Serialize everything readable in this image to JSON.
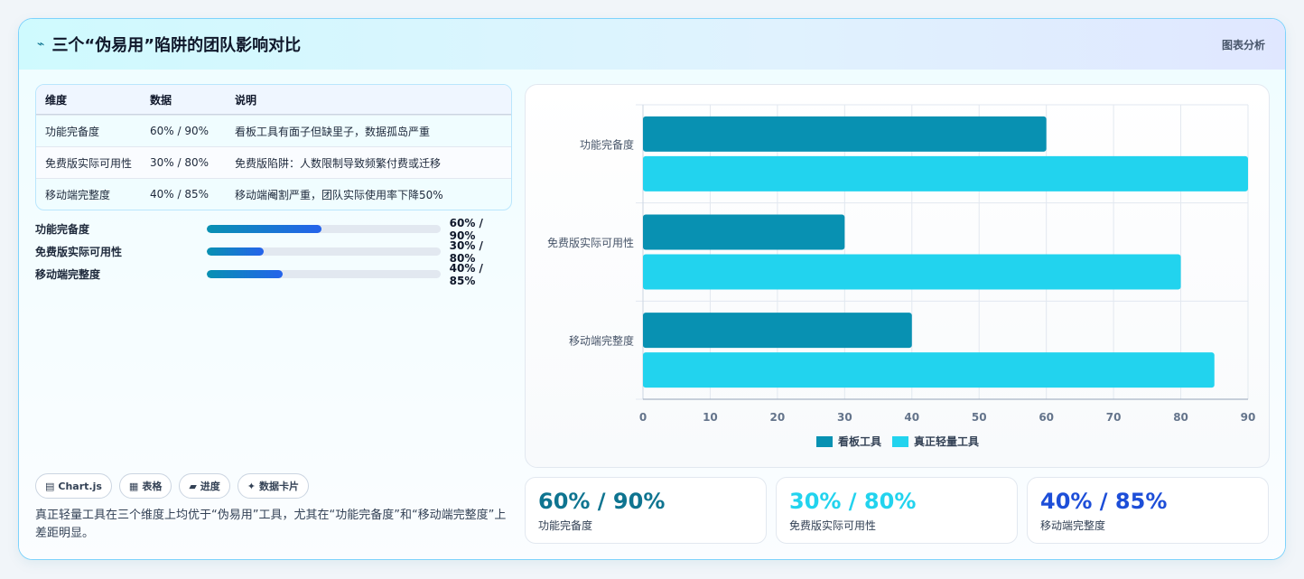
{
  "header": {
    "title": "三个“伪易用”陷阱的团队影响对比",
    "right_label": "图表分析",
    "icon": "lightning-icon"
  },
  "table": {
    "headers": [
      "维度",
      "数据",
      "说明"
    ],
    "rows": [
      {
        "dim": "功能完备度",
        "data": "60% / 90%",
        "desc": "看板工具有面子但缺里子，数据孤岛严重"
      },
      {
        "dim": "免费版实际可用性",
        "data": "30% / 80%",
        "desc": "免费版陷阱：人数限制导致频繁付费或迁移"
      },
      {
        "dim": "移动端完整度",
        "data": "40% / 85%",
        "desc": "移动端阉割严重，团队实际使用率下降50%"
      }
    ]
  },
  "progress": [
    {
      "label": "功能完备度",
      "value": 0.49,
      "text": "60% / 90%"
    },
    {
      "label": "免费版实际可用性",
      "value": 0.245,
      "text": "30% / 80%"
    },
    {
      "label": "移动端完整度",
      "value": 0.325,
      "text": "40% / 85%"
    }
  ],
  "chips": [
    {
      "icon": "chart-icon",
      "glyph": "▤",
      "label": "Chart.js"
    },
    {
      "icon": "table-icon",
      "glyph": "▦",
      "label": "表格"
    },
    {
      "icon": "progress-icon",
      "glyph": "▰",
      "label": "进度"
    },
    {
      "icon": "sparkle-icon",
      "glyph": "✦",
      "label": "数据卡片"
    }
  ],
  "summary": "真正轻量工具在三个维度上均优于“伪易用”工具，尤其在“功能完备度”和“移动端完整度”上差距明显。",
  "stats": [
    {
      "value": "60% / 90%",
      "label": "功能完备度",
      "color": "#0e7490"
    },
    {
      "value": "30% / 80%",
      "label": "免费版实际可用性",
      "color": "#22d3ee"
    },
    {
      "value": "40% / 85%",
      "label": "移动端完整度",
      "color": "#1d4ed8"
    }
  ],
  "chart_data": {
    "type": "bar",
    "orientation": "horizontal",
    "categories": [
      "功能完备度",
      "免费版实际可用性",
      "移动端完整度"
    ],
    "series": [
      {
        "name": "看板工具",
        "values": [
          60,
          30,
          40
        ],
        "color": "#0891b2"
      },
      {
        "name": "真正轻量工具",
        "values": [
          90,
          80,
          85
        ],
        "color": "#22d3ee"
      }
    ],
    "xlim": [
      0,
      90
    ],
    "xticks": [
      0,
      10,
      20,
      30,
      40,
      50,
      60,
      70,
      80,
      90
    ],
    "grid": true,
    "legend": "bottom"
  }
}
